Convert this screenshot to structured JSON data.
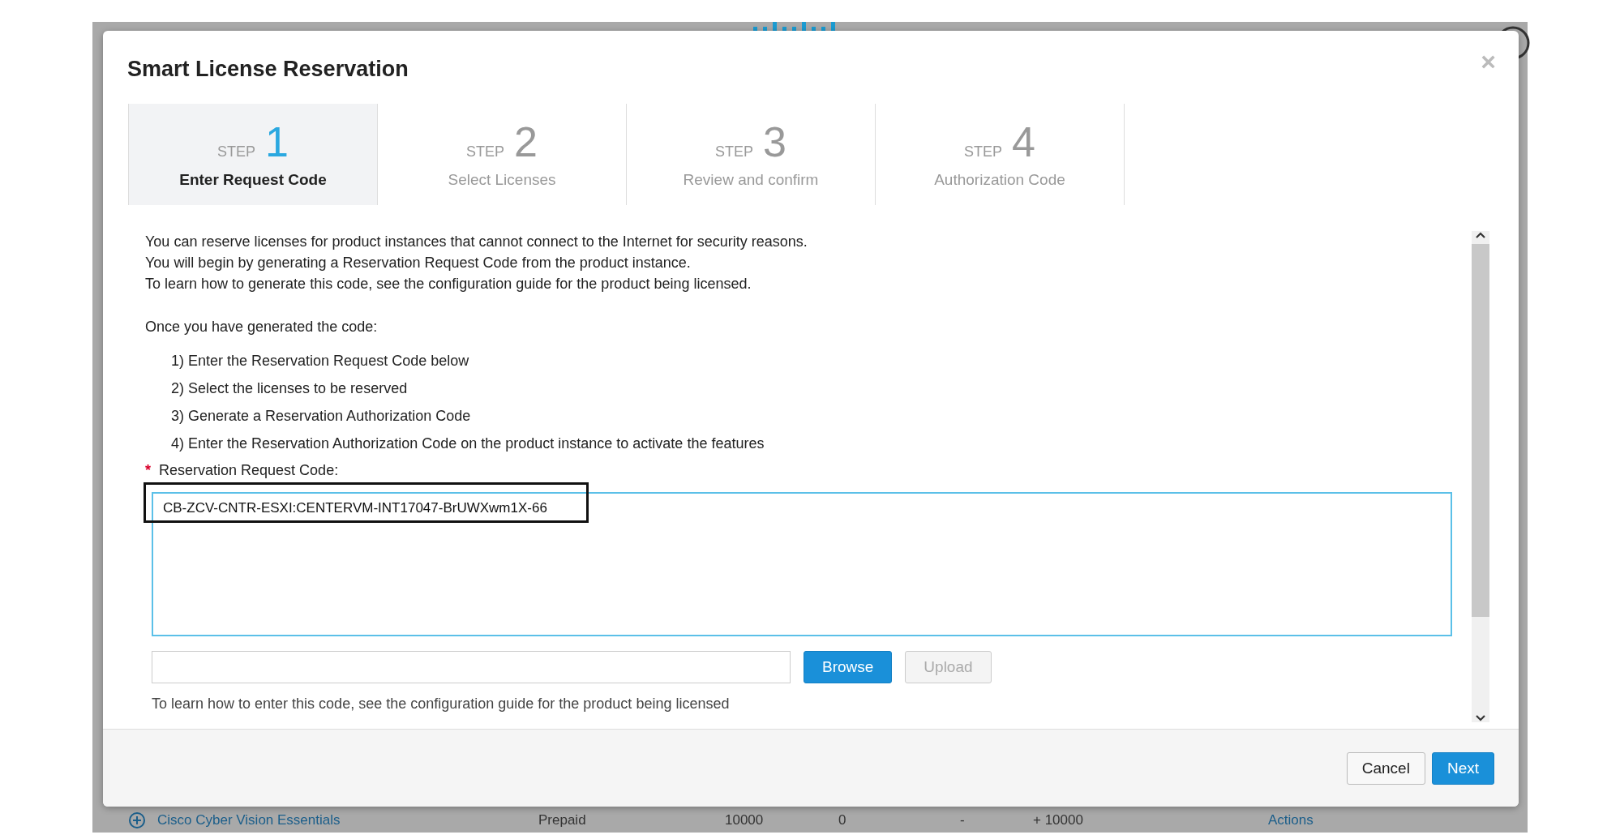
{
  "dialog": {
    "title": "Smart License Reservation",
    "close": "×",
    "steps": [
      {
        "prefix": "STEP",
        "number": "1",
        "label": "Enter Request Code",
        "selected": true
      },
      {
        "prefix": "STEP",
        "number": "2",
        "label": "Select Licenses",
        "selected": false
      },
      {
        "prefix": "STEP",
        "number": "3",
        "label": "Review and confirm",
        "selected": false
      },
      {
        "prefix": "STEP",
        "number": "4",
        "label": "Authorization Code",
        "selected": false
      }
    ],
    "intro": [
      "You can reserve licenses for product instances that cannot connect to the Internet for security reasons.",
      "You will begin by generating a Reservation Request Code from the product instance.",
      "To learn how to generate this code, see the configuration guide for the product being licensed."
    ],
    "once": "Once you have generated the code:",
    "instructions": [
      "1) Enter the Reservation Request Code below",
      "2) Select the licenses to be reserved",
      "3) Generate a Reservation Authorization Code",
      "4) Enter the Reservation Authorization Code on the product instance to activate the features"
    ],
    "field_label": {
      "required_mark": "*",
      "text": "Reservation Request Code:"
    },
    "request_code": "CB-ZCV-CNTR-ESXI:CENTERVM-INT17047-BrUWXwm1X-66",
    "file_buttons": [
      {
        "label": "Browse",
        "disabled": false
      },
      {
        "label": "Upload",
        "disabled": true
      }
    ],
    "hint": "To learn how to enter this code, see the configuration guide for the product being licensed",
    "footer_buttons": [
      {
        "label": "Cancel",
        "primary": false
      },
      {
        "label": "Next",
        "primary": true
      }
    ]
  },
  "background_row": [
    "Cisco Cyber Vision Essentials",
    "Prepaid",
    "10000",
    "0",
    "-",
    "+ 10000",
    "Actions"
  ]
}
